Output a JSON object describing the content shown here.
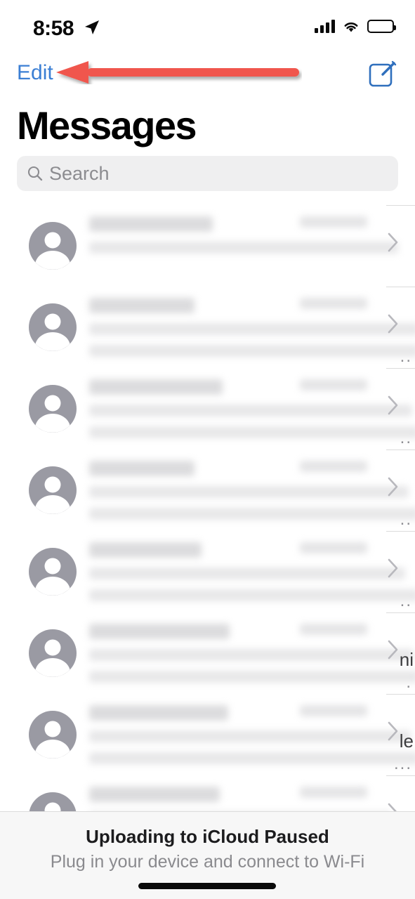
{
  "status_bar": {
    "time": "8:58",
    "location_icon": "location-arrow-icon",
    "cellular_icon": "cellular-signal-icon",
    "wifi_icon": "wifi-icon",
    "battery_icon": "battery-full-icon"
  },
  "nav": {
    "edit_label": "Edit",
    "compose_icon": "compose-message-icon",
    "edit_color": "#3b7fd4"
  },
  "annotation": {
    "type": "arrow",
    "direction": "left",
    "points_to": "Edit",
    "color": "#f0574d"
  },
  "header": {
    "title": "Messages"
  },
  "search": {
    "placeholder": "Search",
    "value": "",
    "icon": "search-icon"
  },
  "conversations": [
    {
      "title": "",
      "time": "",
      "preview_line1": "",
      "preview_line2": "",
      "blurred": true,
      "avatar_icon": "person-placeholder-icon",
      "chevron_icon": "chevron-right-icon",
      "edge_fragment": "",
      "edge_dots": ""
    },
    {
      "title": "",
      "time": "",
      "preview_line1": "",
      "preview_line2": "",
      "blurred": true,
      "avatar_icon": "person-placeholder-icon",
      "chevron_icon": "chevron-right-icon",
      "edge_fragment": "",
      "edge_dots": ".."
    },
    {
      "title": "",
      "time": "",
      "preview_line1": "",
      "preview_line2": "",
      "blurred": true,
      "avatar_icon": "person-placeholder-icon",
      "chevron_icon": "chevron-right-icon",
      "edge_fragment": "",
      "edge_dots": ".."
    },
    {
      "title": "",
      "time": "",
      "preview_line1": "",
      "preview_line2": "",
      "blurred": true,
      "avatar_icon": "person-placeholder-icon",
      "chevron_icon": "chevron-right-icon",
      "edge_fragment": "",
      "edge_dots": ".."
    },
    {
      "title": "",
      "time": "",
      "preview_line1": "",
      "preview_line2": "",
      "blurred": true,
      "avatar_icon": "person-placeholder-icon",
      "chevron_icon": "chevron-right-icon",
      "edge_fragment": "",
      "edge_dots": ".."
    },
    {
      "title": "",
      "time": "",
      "preview_line1": "",
      "preview_line2": "",
      "blurred": true,
      "avatar_icon": "person-placeholder-icon",
      "chevron_icon": "chevron-right-icon",
      "edge_fragment": "ni",
      "edge_dots": "."
    },
    {
      "title": "",
      "time": "",
      "preview_line1": "",
      "preview_line2": "",
      "blurred": true,
      "avatar_icon": "person-placeholder-icon",
      "chevron_icon": "chevron-right-icon",
      "edge_fragment": "le",
      "edge_dots": "..."
    },
    {
      "title": "",
      "time": "",
      "preview_line1": "",
      "preview_line2": "",
      "blurred": true,
      "avatar_icon": "person-placeholder-icon",
      "chevron_icon": "chevron-right-icon",
      "edge_fragment": "",
      "edge_dots": ""
    }
  ],
  "footer": {
    "title": "Uploading to iCloud Paused",
    "subtitle": "Plug in your device and connect to Wi-Fi"
  },
  "home_indicator": "home-indicator"
}
